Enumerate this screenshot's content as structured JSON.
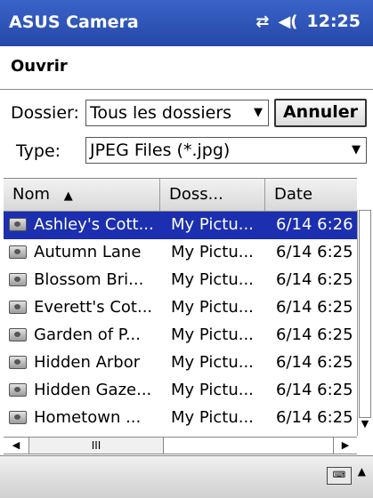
{
  "titlebar": {
    "app_title": "ASUS Camera",
    "time": "12:25",
    "sync_icon": "⇄",
    "volume_icon": "◀("
  },
  "header": {
    "title": "Ouvrir"
  },
  "filters": {
    "folder_label": "Dossier:",
    "folder_value": "Tous les dossiers",
    "cancel_button": "Annuler",
    "type_label": "Type:",
    "type_value": "JPEG Files (*.jpg)"
  },
  "list": {
    "columns": {
      "name": "Nom",
      "sort_indicator": "▲",
      "folder": "Doss...",
      "date": "Date"
    },
    "rows": [
      {
        "name": "Ashley's Cott...",
        "folder": "My Pictu...",
        "date": "6/14 6:26",
        "selected": true
      },
      {
        "name": "Autumn Lane",
        "folder": "My Pictu...",
        "date": "6/14 6:25"
      },
      {
        "name": "Blossom Bri...",
        "folder": "My Pictu...",
        "date": "6/14 6:25"
      },
      {
        "name": "Everett's Cot...",
        "folder": "My Pictu...",
        "date": "6/14 6:25"
      },
      {
        "name": "Garden of P...",
        "folder": "My Pictu...",
        "date": "6/14 6:25"
      },
      {
        "name": "Hidden Arbor",
        "folder": "My Pictu...",
        "date": "6/14 6:25"
      },
      {
        "name": "Hidden Gaze...",
        "folder": "My Pictu...",
        "date": "6/14 6:25"
      },
      {
        "name": "Hometown ...",
        "folder": "My Pictu...",
        "date": "6/14 6:25"
      }
    ]
  },
  "scroll": {
    "left": "◀",
    "right": "▶",
    "down": "▼",
    "grip": "III"
  },
  "bottom": {
    "keyboard_icon": "⌨",
    "up_arrow": "▲"
  }
}
